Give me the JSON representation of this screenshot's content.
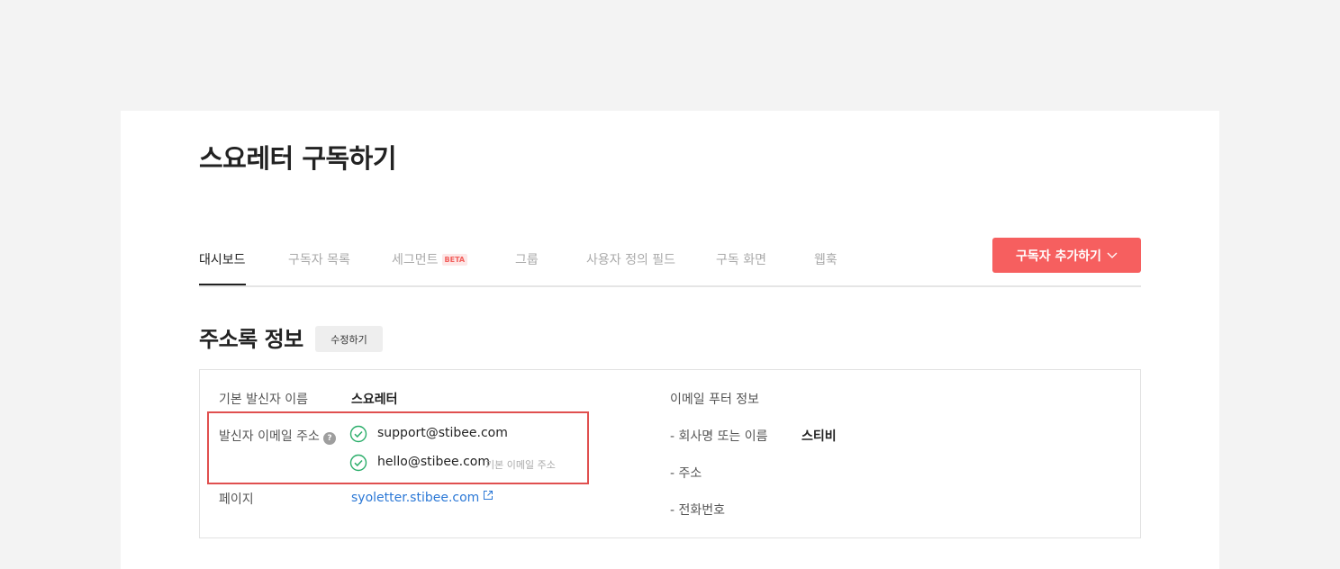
{
  "page": {
    "title": "스요레터 구독하기"
  },
  "tabs": [
    {
      "label": "대시보드",
      "active": true
    },
    {
      "label": "구독자 목록",
      "active": false
    },
    {
      "label": "세그먼트",
      "badge": "BETA",
      "active": false
    },
    {
      "label": "그룹",
      "active": false
    },
    {
      "label": "사용자 정의 필드",
      "active": false
    },
    {
      "label": "구독 화면",
      "active": false
    },
    {
      "label": "웹훅",
      "active": false
    }
  ],
  "add_subscriber_button": {
    "label": "구독자 추가하기",
    "icon": "chevron-down-icon"
  },
  "section": {
    "title": "주소록 정보",
    "edit_label": "수정하기"
  },
  "info": {
    "sender_name_label": "기본 발신자 이름",
    "sender_name_value": "스요레터",
    "sender_email_label": "발신자 이메일 주소",
    "help_glyph": "?",
    "emails": [
      {
        "address": "support@stibee.com",
        "verified": true
      },
      {
        "address": "hello@stibee.com",
        "verified": true,
        "note": "기본 이메일 주소"
      }
    ],
    "page_label": "페이지",
    "page_link": "syoletter.stibee.com",
    "footer_title": "이메일 푸터 정보",
    "company_label": "- 회사명 또는 이름",
    "company_value": "스티비",
    "address_label": "- 주소",
    "phone_label": "- 전화번호"
  },
  "colors": {
    "accent": "#f65f5f",
    "highlight": "#e0504f",
    "verified": "#2cae6b",
    "link": "#2b78d6"
  }
}
